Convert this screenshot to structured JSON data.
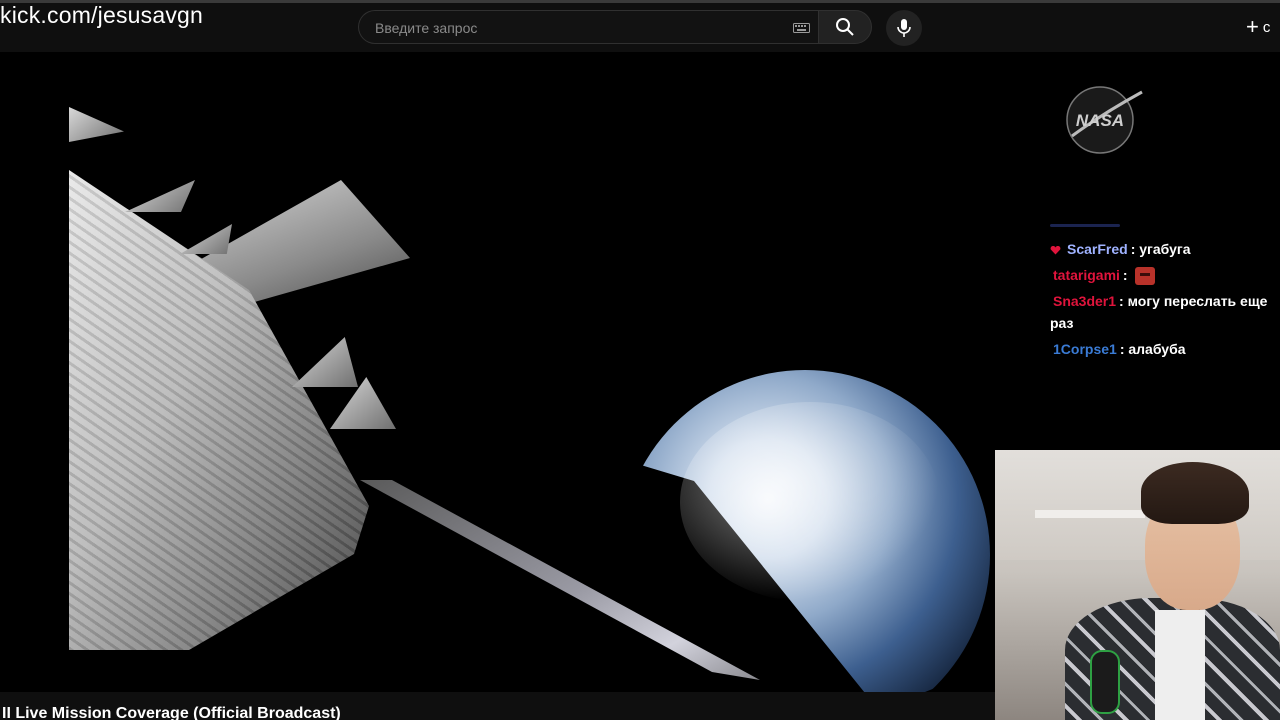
{
  "overlay": {
    "url_text": "kick.com/jesusavgn"
  },
  "header": {
    "search_placeholder": "Введите запрос",
    "search_value": "",
    "keyboard_icon": "keyboard-icon",
    "search_icon": "search-icon",
    "mic_icon": "microphone-icon",
    "create_label": "c",
    "create_icon": "plus-icon"
  },
  "video": {
    "title": "II Live Mission Coverage (Official Broadcast)"
  },
  "stream": {
    "logo": "NASA",
    "chat": [
      {
        "user": "ScarFred",
        "color": "#9fb2ff",
        "badge": "heart-badge-icon",
        "text": "угабуга"
      },
      {
        "user": "tatarigami",
        "color": "#e0143c",
        "badge": "",
        "emote": "angry-face-emote",
        "text": ""
      },
      {
        "user": "Sna3der1",
        "color": "#e0143c",
        "badge": "",
        "text": "могу переслать еще раз"
      },
      {
        "user": "1Corpse1",
        "color": "#3a7bd5",
        "badge": "",
        "text": "алабуба"
      }
    ],
    "separator": ":"
  }
}
